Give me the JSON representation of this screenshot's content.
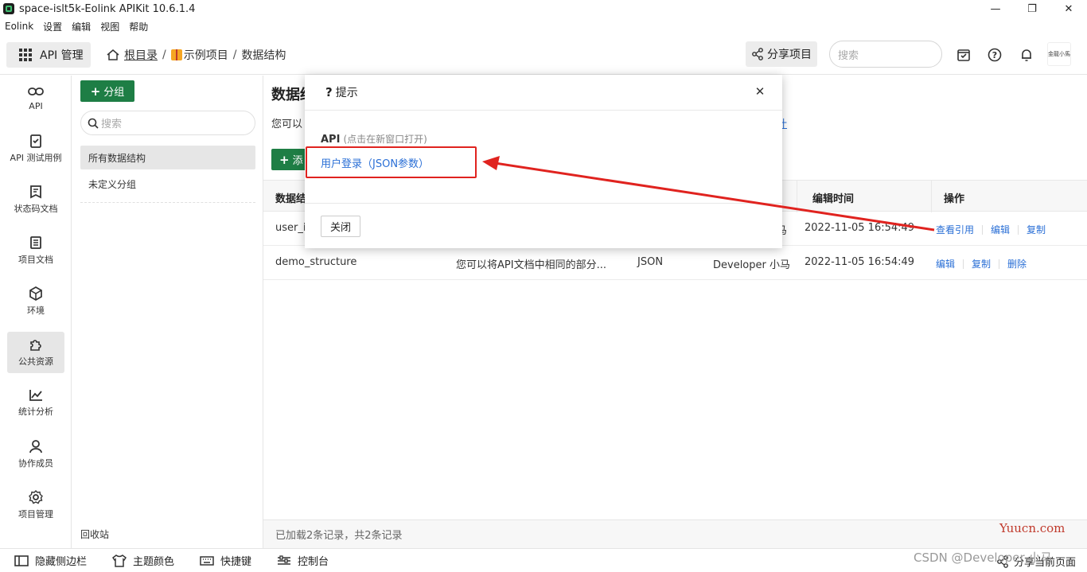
{
  "window": {
    "title": "space-islt5k-Eolink APIKit 10.6.1.4",
    "minimize": "—",
    "maximize": "❐",
    "close": "✕"
  },
  "menubar": [
    "Eolink",
    "设置",
    "编辑",
    "视图",
    "帮助"
  ],
  "header": {
    "module": "API 管理",
    "breadcrumb": {
      "root": "根目录",
      "sep": "/",
      "project": "示例项目",
      "current": "数据结构"
    },
    "share_project": "分享项目",
    "search_placeholder": "搜索",
    "avatar_text": "金龍小馬"
  },
  "leftnav": [
    {
      "label": "API",
      "icon": "link-icon"
    },
    {
      "label": "API 测试用例",
      "icon": "clipboard-check-icon"
    },
    {
      "label": "状态码文档",
      "icon": "doc-icon"
    },
    {
      "label": "项目文档",
      "icon": "doc-lines-icon"
    },
    {
      "label": "环境",
      "icon": "cube-icon"
    },
    {
      "label": "公共资源",
      "icon": "puzzle-icon",
      "active": true
    },
    {
      "label": "统计分析",
      "icon": "chart-line-icon"
    },
    {
      "label": "协作成员",
      "icon": "user-icon"
    },
    {
      "label": "项目管理",
      "icon": "gear-icon"
    }
  ],
  "groups": {
    "add_label": "分组",
    "search_placeholder": "搜索",
    "items": [
      "所有数据结构",
      "未定义分组"
    ],
    "recycle": "回收站"
  },
  "main": {
    "title": "数据结",
    "desc": "您可以",
    "desc_tail": "计",
    "add_label": "添",
    "columns": [
      "数据结",
      "编辑时间",
      "操作"
    ],
    "rows": [
      {
        "name": "user_i",
        "desc": "",
        "type": "",
        "editor": "马",
        "time": "2022-11-05 16:54:49",
        "ops": [
          "查看引用",
          "编辑",
          "复制"
        ]
      },
      {
        "name": "demo_structure",
        "desc": "您可以将API文档中相同的部分...",
        "type": "JSON",
        "editor": "Developer 小马",
        "time": "2022-11-05 16:54:49",
        "ops": [
          "编辑",
          "复制",
          "删除"
        ]
      }
    ],
    "status": "已加载2条记录，共2条记录"
  },
  "modal": {
    "title": "提示",
    "section": "API",
    "section_hint": "(点击在新窗口打开)",
    "link": "用户登录（JSON参数）",
    "close_button": "关闭"
  },
  "bottombar": {
    "items": [
      "隐藏侧边栏",
      "主题颜色",
      "快捷键",
      "控制台"
    ],
    "share_page": "分享当前页面"
  },
  "watermarks": {
    "yuucn": "Yuucn.com",
    "csdn": "CSDN @Developer 小马"
  },
  "colors": {
    "brand_green": "#1e7e45",
    "link_blue": "#2a6fd6",
    "annotation_red": "#e0231f"
  }
}
